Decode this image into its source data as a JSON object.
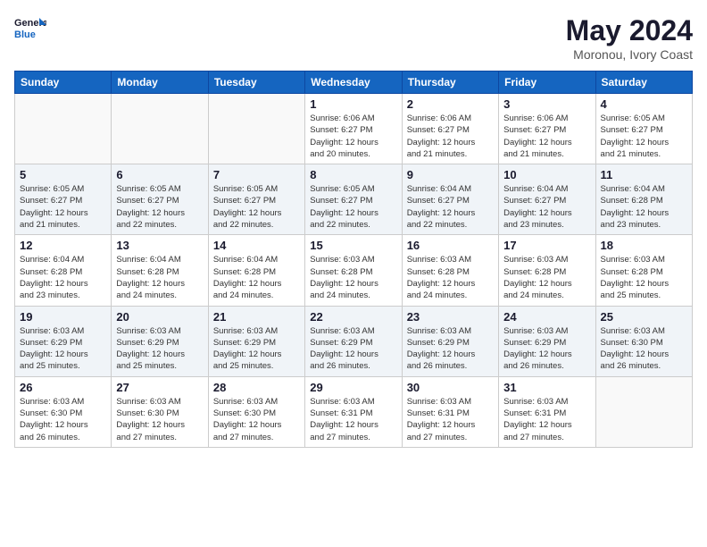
{
  "logo": {
    "line1": "General",
    "line2": "Blue"
  },
  "title": "May 2024",
  "subtitle": "Moronou, Ivory Coast",
  "days_of_week": [
    "Sunday",
    "Monday",
    "Tuesday",
    "Wednesday",
    "Thursday",
    "Friday",
    "Saturday"
  ],
  "weeks": [
    {
      "shaded": false,
      "days": [
        {
          "num": "",
          "info": ""
        },
        {
          "num": "",
          "info": ""
        },
        {
          "num": "",
          "info": ""
        },
        {
          "num": "1",
          "info": "Sunrise: 6:06 AM\nSunset: 6:27 PM\nDaylight: 12 hours\nand 20 minutes."
        },
        {
          "num": "2",
          "info": "Sunrise: 6:06 AM\nSunset: 6:27 PM\nDaylight: 12 hours\nand 21 minutes."
        },
        {
          "num": "3",
          "info": "Sunrise: 6:06 AM\nSunset: 6:27 PM\nDaylight: 12 hours\nand 21 minutes."
        },
        {
          "num": "4",
          "info": "Sunrise: 6:05 AM\nSunset: 6:27 PM\nDaylight: 12 hours\nand 21 minutes."
        }
      ]
    },
    {
      "shaded": true,
      "days": [
        {
          "num": "5",
          "info": "Sunrise: 6:05 AM\nSunset: 6:27 PM\nDaylight: 12 hours\nand 21 minutes."
        },
        {
          "num": "6",
          "info": "Sunrise: 6:05 AM\nSunset: 6:27 PM\nDaylight: 12 hours\nand 22 minutes."
        },
        {
          "num": "7",
          "info": "Sunrise: 6:05 AM\nSunset: 6:27 PM\nDaylight: 12 hours\nand 22 minutes."
        },
        {
          "num": "8",
          "info": "Sunrise: 6:05 AM\nSunset: 6:27 PM\nDaylight: 12 hours\nand 22 minutes."
        },
        {
          "num": "9",
          "info": "Sunrise: 6:04 AM\nSunset: 6:27 PM\nDaylight: 12 hours\nand 22 minutes."
        },
        {
          "num": "10",
          "info": "Sunrise: 6:04 AM\nSunset: 6:27 PM\nDaylight: 12 hours\nand 23 minutes."
        },
        {
          "num": "11",
          "info": "Sunrise: 6:04 AM\nSunset: 6:28 PM\nDaylight: 12 hours\nand 23 minutes."
        }
      ]
    },
    {
      "shaded": false,
      "days": [
        {
          "num": "12",
          "info": "Sunrise: 6:04 AM\nSunset: 6:28 PM\nDaylight: 12 hours\nand 23 minutes."
        },
        {
          "num": "13",
          "info": "Sunrise: 6:04 AM\nSunset: 6:28 PM\nDaylight: 12 hours\nand 24 minutes."
        },
        {
          "num": "14",
          "info": "Sunrise: 6:04 AM\nSunset: 6:28 PM\nDaylight: 12 hours\nand 24 minutes."
        },
        {
          "num": "15",
          "info": "Sunrise: 6:03 AM\nSunset: 6:28 PM\nDaylight: 12 hours\nand 24 minutes."
        },
        {
          "num": "16",
          "info": "Sunrise: 6:03 AM\nSunset: 6:28 PM\nDaylight: 12 hours\nand 24 minutes."
        },
        {
          "num": "17",
          "info": "Sunrise: 6:03 AM\nSunset: 6:28 PM\nDaylight: 12 hours\nand 24 minutes."
        },
        {
          "num": "18",
          "info": "Sunrise: 6:03 AM\nSunset: 6:28 PM\nDaylight: 12 hours\nand 25 minutes."
        }
      ]
    },
    {
      "shaded": true,
      "days": [
        {
          "num": "19",
          "info": "Sunrise: 6:03 AM\nSunset: 6:29 PM\nDaylight: 12 hours\nand 25 minutes."
        },
        {
          "num": "20",
          "info": "Sunrise: 6:03 AM\nSunset: 6:29 PM\nDaylight: 12 hours\nand 25 minutes."
        },
        {
          "num": "21",
          "info": "Sunrise: 6:03 AM\nSunset: 6:29 PM\nDaylight: 12 hours\nand 25 minutes."
        },
        {
          "num": "22",
          "info": "Sunrise: 6:03 AM\nSunset: 6:29 PM\nDaylight: 12 hours\nand 26 minutes."
        },
        {
          "num": "23",
          "info": "Sunrise: 6:03 AM\nSunset: 6:29 PM\nDaylight: 12 hours\nand 26 minutes."
        },
        {
          "num": "24",
          "info": "Sunrise: 6:03 AM\nSunset: 6:29 PM\nDaylight: 12 hours\nand 26 minutes."
        },
        {
          "num": "25",
          "info": "Sunrise: 6:03 AM\nSunset: 6:30 PM\nDaylight: 12 hours\nand 26 minutes."
        }
      ]
    },
    {
      "shaded": false,
      "days": [
        {
          "num": "26",
          "info": "Sunrise: 6:03 AM\nSunset: 6:30 PM\nDaylight: 12 hours\nand 26 minutes."
        },
        {
          "num": "27",
          "info": "Sunrise: 6:03 AM\nSunset: 6:30 PM\nDaylight: 12 hours\nand 27 minutes."
        },
        {
          "num": "28",
          "info": "Sunrise: 6:03 AM\nSunset: 6:30 PM\nDaylight: 12 hours\nand 27 minutes."
        },
        {
          "num": "29",
          "info": "Sunrise: 6:03 AM\nSunset: 6:31 PM\nDaylight: 12 hours\nand 27 minutes."
        },
        {
          "num": "30",
          "info": "Sunrise: 6:03 AM\nSunset: 6:31 PM\nDaylight: 12 hours\nand 27 minutes."
        },
        {
          "num": "31",
          "info": "Sunrise: 6:03 AM\nSunset: 6:31 PM\nDaylight: 12 hours\nand 27 minutes."
        },
        {
          "num": "",
          "info": ""
        }
      ]
    }
  ]
}
